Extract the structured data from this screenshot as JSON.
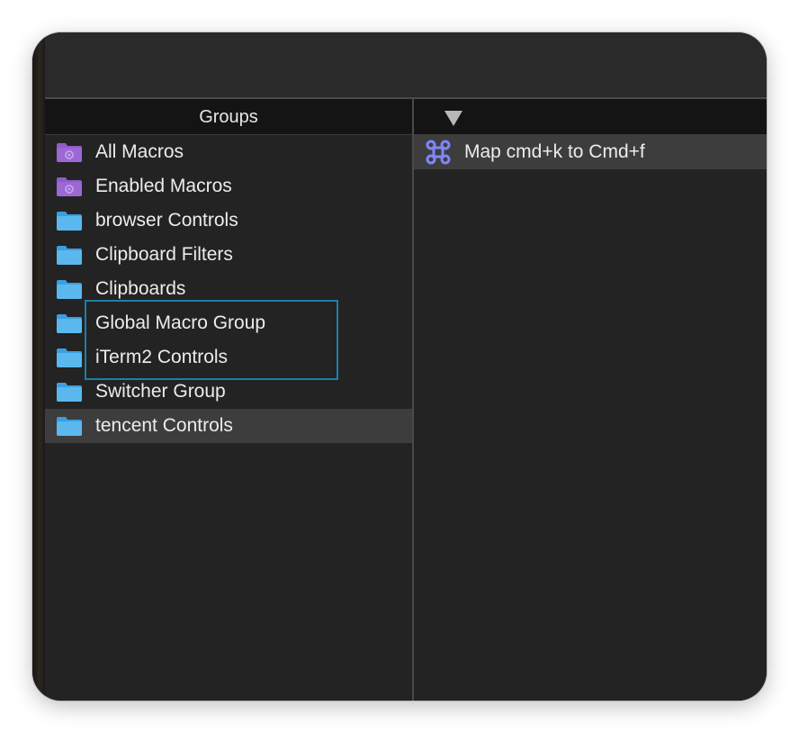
{
  "colors": {
    "folder_blue": "#5ab8ee",
    "folder_purple": "#8e5bc9",
    "command_icon": "#7f86ff",
    "highlight_border": "#1f7ea8"
  },
  "groups": {
    "header": "Groups",
    "items": [
      {
        "label": "All Macros",
        "icon": "smart-folder-icon",
        "selected": false
      },
      {
        "label": "Enabled Macros",
        "icon": "smart-folder-icon",
        "selected": false
      },
      {
        "label": "browser Controls",
        "icon": "folder-icon",
        "selected": false
      },
      {
        "label": "Clipboard Filters",
        "icon": "folder-icon",
        "selected": false
      },
      {
        "label": "Clipboards",
        "icon": "folder-icon",
        "selected": false
      },
      {
        "label": "Global Macro Group",
        "icon": "folder-icon",
        "selected": false
      },
      {
        "label": "iTerm2 Controls",
        "icon": "folder-icon",
        "selected": false
      },
      {
        "label": "Switcher Group",
        "icon": "folder-icon",
        "selected": false
      },
      {
        "label": "tencent Controls",
        "icon": "folder-icon",
        "selected": true
      }
    ]
  },
  "macros": {
    "sort_icon": "sort-descending-icon",
    "items": [
      {
        "label": "Map cmd+k to Cmd+f",
        "icon": "command-key-icon",
        "selected": true
      }
    ]
  }
}
